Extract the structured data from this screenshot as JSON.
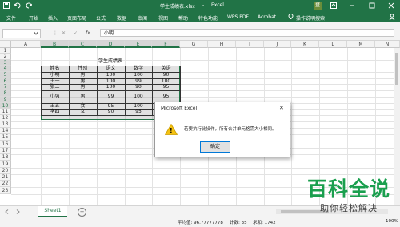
{
  "titlebar": {
    "filename": "学生成绩表.xlsx",
    "separator": "-",
    "app": "Excel",
    "user_initial": "登",
    "colors": {
      "background": "#217346",
      "text": "#ffffff"
    }
  },
  "ribbon": {
    "tabs": [
      "文件",
      "开始",
      "插入",
      "页面布局",
      "公式",
      "数据",
      "审阅",
      "视图",
      "帮助",
      "特色功能",
      "WPS PDF",
      "Acrobat",
      "操作说明搜索"
    ],
    "lightbulb_icon": "lightbulb-icon",
    "share_icon": "share-icon"
  },
  "formula_bar": {
    "name_box": "",
    "cancel_symbol": "✕",
    "enter_symbol": "✓",
    "fx_label": "fx",
    "value": "小明"
  },
  "grid": {
    "columns": [
      "A",
      "B",
      "C",
      "D",
      "E",
      "F",
      "G",
      "H",
      "I",
      "J",
      "K",
      "L",
      "M",
      "N"
    ],
    "rows": [
      "1",
      "2",
      "3",
      "4",
      "5",
      "6",
      "7",
      "8",
      "9",
      "10",
      "11",
      "12",
      "13",
      "14",
      "15",
      "16",
      "17",
      "18",
      "19",
      "20",
      "21",
      "22",
      "23"
    ],
    "table_title": "学生成绩表",
    "headers": [
      "姓名",
      "性别",
      "语文",
      "数学",
      "英语"
    ],
    "records": [
      [
        "小明",
        "男",
        "100",
        "100",
        "90"
      ],
      [
        "王一",
        "男",
        "100",
        "99",
        "100"
      ],
      [
        "张三",
        "男",
        "100",
        "90",
        "95"
      ],
      [
        "小强",
        "男",
        "99",
        "100",
        "95"
      ],
      [
        "王五",
        "女",
        "95",
        "100",
        "88"
      ],
      [
        "李四",
        "女",
        "90",
        "95",
        ""
      ]
    ]
  },
  "dialog": {
    "title": "Microsoft Excel",
    "message": "若要执行此操作，所有合并单元格需大小相同。",
    "ok_label": "确定",
    "close_symbol": "✕",
    "warning_symbol": "!"
  },
  "sheet_tabs": {
    "active": "Sheet1",
    "add_symbol": "+"
  },
  "status_bar": {
    "average": "平均值: 96.77777778",
    "count": "计数: 35",
    "sum": "求和: 1742",
    "zoom": "100%"
  },
  "watermark": {
    "title": "百科全说",
    "subtitle": "助你轻松解决"
  }
}
